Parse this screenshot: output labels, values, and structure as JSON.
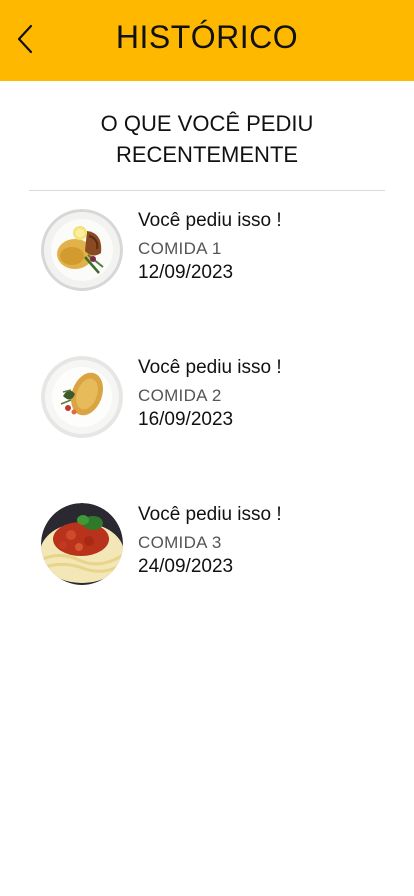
{
  "header": {
    "title": "HISTÓRICO",
    "back_icon": "chevron-left-icon",
    "color": "#FFB800"
  },
  "subtitle": {
    "line1": "O QUE VOCÊ PEDIU",
    "line2": "RECENTEMENTE"
  },
  "orders": [
    {
      "message": "Você pediu isso !",
      "name": "COMIDA 1",
      "date": "12/09/2023"
    },
    {
      "message": "Você pediu isso !",
      "name": "COMIDA 2",
      "date": "16/09/2023"
    },
    {
      "message": "Você pediu isso !",
      "name": "COMIDA 3",
      "date": "24/09/2023"
    }
  ]
}
